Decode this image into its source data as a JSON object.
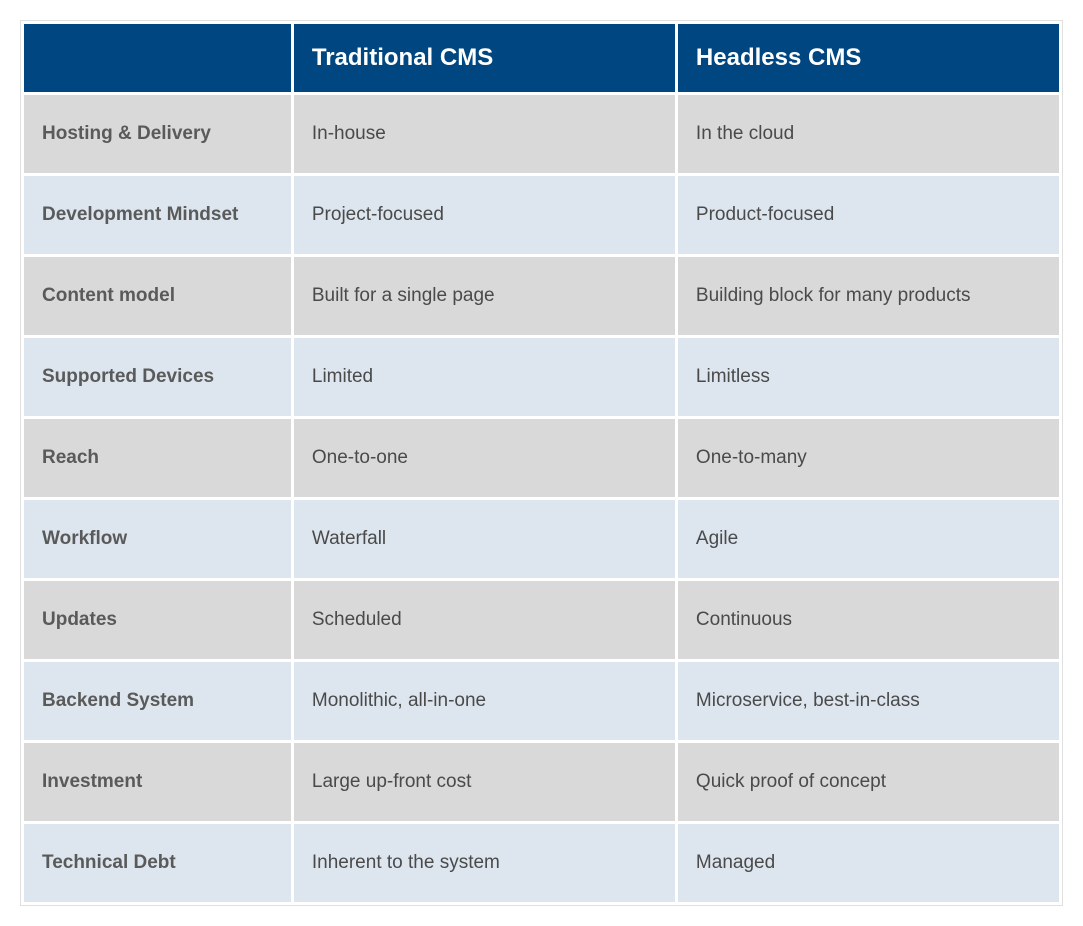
{
  "chart_data": {
    "type": "table",
    "columns": [
      "",
      "Traditional CMS",
      "Headless CMS"
    ],
    "rows": [
      [
        "Hosting & Delivery",
        "In-house",
        "In the cloud"
      ],
      [
        "Development Mindset",
        "Project-focused",
        "Product-focused"
      ],
      [
        "Content model",
        "Built for a single page",
        "Building block for many products"
      ],
      [
        "Supported Devices",
        "Limited",
        "Limitless"
      ],
      [
        "Reach",
        "One-to-one",
        "One-to-many"
      ],
      [
        "Workflow",
        "Waterfall",
        "Agile"
      ],
      [
        "Updates",
        "Scheduled",
        "Continuous"
      ],
      [
        "Backend System",
        "Monolithic, all-in-one",
        "Microservice, best-in-class"
      ],
      [
        "Investment",
        "Large up-front cost",
        "Quick proof of concept"
      ],
      [
        "Technical Debt",
        "Inherent to the system",
        "Managed"
      ]
    ]
  },
  "header": {
    "col0": "",
    "col1": "Traditional CMS",
    "col2": "Headless CMS"
  },
  "rows": [
    {
      "label": "Hosting & Delivery",
      "traditional": "In-house",
      "headless": "In the cloud"
    },
    {
      "label": "Development Mindset",
      "traditional": "Project-focused",
      "headless": "Product-focused"
    },
    {
      "label": "Content model",
      "traditional": "Built for a single page",
      "headless": "Building block for many products"
    },
    {
      "label": "Supported Devices",
      "traditional": "Limited",
      "headless": "Limitless"
    },
    {
      "label": "Reach",
      "traditional": "One-to-one",
      "headless": "One-to-many"
    },
    {
      "label": "Workflow",
      "traditional": "Waterfall",
      "headless": "Agile"
    },
    {
      "label": "Updates",
      "traditional": "Scheduled",
      "headless": "Continuous"
    },
    {
      "label": "Backend System",
      "traditional": "Monolithic, all-in-one",
      "headless": "Microservice, best-in-class"
    },
    {
      "label": "Investment",
      "traditional": "Large up-front cost",
      "headless": "Quick proof of concept"
    },
    {
      "label": "Technical Debt",
      "traditional": "Inherent to the system",
      "headless": "Managed"
    }
  ]
}
